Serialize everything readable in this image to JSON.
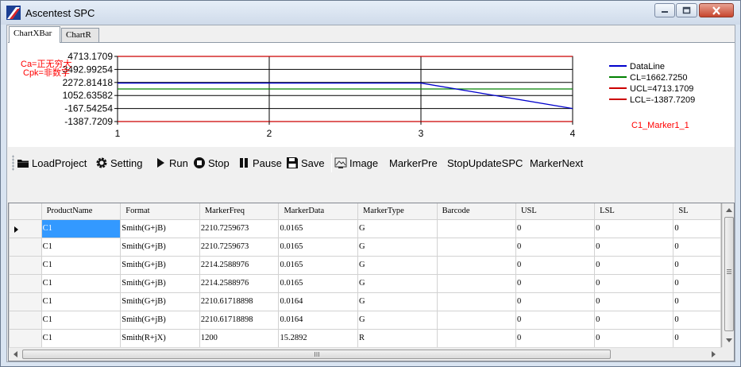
{
  "window": {
    "title": "Ascentest SPC",
    "minimize_icon": "minimize-icon",
    "maximize_icon": "maximize-icon",
    "close_icon": "close-icon"
  },
  "tabs": [
    {
      "label": "ChartXBar",
      "active": true
    },
    {
      "label": "ChartR",
      "active": false
    }
  ],
  "chart_labels": {
    "ca": "Ca=正无穷大",
    "cpk": "Cpk=非数字",
    "marker": "C1_Marker1_1"
  },
  "chart_data": {
    "type": "line",
    "x": [
      1,
      2,
      3,
      4
    ],
    "xticks": [
      "1",
      "2",
      "3",
      "4"
    ],
    "yticks": [
      "4713.1709",
      "3492.99254",
      "2272.81418",
      "1052.63582",
      "-167.54254",
      "-1387.7209"
    ],
    "ylim": [
      -1387.7209,
      4713.1709
    ],
    "grid": true,
    "legend_position": "right",
    "series": [
      {
        "name": "DataLine",
        "color": "#0000cc",
        "values": [
          2210.73,
          2210.73,
          2214.26,
          -167.5
        ]
      },
      {
        "name": "CL=1662.7250",
        "color": "#008000",
        "values": [
          1662.725,
          1662.725,
          1662.725,
          1662.725
        ]
      },
      {
        "name": "UCL=4713.1709",
        "color": "#cc0000",
        "values": [
          4713.1709,
          4713.1709,
          4713.1709,
          4713.1709
        ]
      },
      {
        "name": "LCL=-1387.7209",
        "color": "#cc0000",
        "values": [
          -1387.7209,
          -1387.7209,
          -1387.7209,
          -1387.7209
        ]
      }
    ]
  },
  "toolbar": {
    "items": [
      {
        "label": "LoadProject",
        "icon": "folder-icon"
      },
      {
        "label": "Setting",
        "icon": "gear-icon"
      },
      {
        "label": "Run",
        "icon": "play-icon"
      },
      {
        "label": "Stop",
        "icon": "stop-icon"
      },
      {
        "label": "Pause",
        "icon": "pause-icon"
      },
      {
        "label": "Save",
        "icon": "save-icon"
      },
      {
        "label": "Image",
        "icon": "image-icon"
      },
      {
        "label": "MarkerPre",
        "icon": ""
      },
      {
        "label": "StopUpdateSPC",
        "icon": ""
      },
      {
        "label": "MarkerNext",
        "icon": ""
      }
    ]
  },
  "grid": {
    "columns": [
      "ProductName",
      "Format",
      "MarkerFreq",
      "MarkerData",
      "MarkerType",
      "Barcode",
      "USL",
      "LSL",
      "SL"
    ],
    "rows": [
      [
        "C1",
        "Smith(G+jB)",
        "2210.7259673",
        "0.0165",
        "G",
        "",
        "0",
        "0",
        "0"
      ],
      [
        "C1",
        "Smith(G+jB)",
        "2210.7259673",
        "0.0165",
        "G",
        "",
        "0",
        "0",
        "0"
      ],
      [
        "C1",
        "Smith(G+jB)",
        "2214.2588976",
        "0.0165",
        "G",
        "",
        "0",
        "0",
        "0"
      ],
      [
        "C1",
        "Smith(G+jB)",
        "2214.2588976",
        "0.0165",
        "G",
        "",
        "0",
        "0",
        "0"
      ],
      [
        "C1",
        "Smith(G+jB)",
        "2210.61718898",
        "0.0164",
        "G",
        "",
        "0",
        "0",
        "0"
      ],
      [
        "C1",
        "Smith(G+jB)",
        "2210.61718898",
        "0.0164",
        "G",
        "",
        "0",
        "0",
        "0"
      ],
      [
        "C1",
        "Smith(R+jX)",
        "1200",
        "15.2892",
        "R",
        "",
        "0",
        "0",
        "0"
      ]
    ],
    "selected_row": 0
  }
}
